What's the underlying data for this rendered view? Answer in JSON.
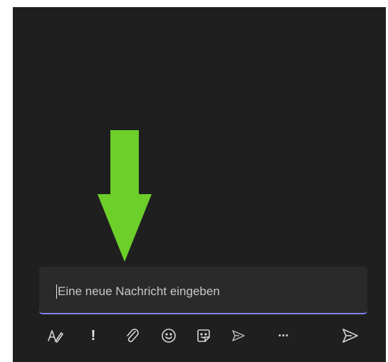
{
  "compose": {
    "placeholder": "Eine neue Nachricht eingeben",
    "accent_color": "#7f85f5"
  },
  "annotation": {
    "arrow_color": "#6ccf2a"
  },
  "toolbar": {
    "items": [
      {
        "name": "format-icon"
      },
      {
        "name": "important-icon",
        "label": "!"
      },
      {
        "name": "attach-icon"
      },
      {
        "name": "emoji-icon"
      },
      {
        "name": "sticker-icon"
      },
      {
        "name": "schedule-send-icon"
      },
      {
        "name": "more-options-icon",
        "label": "···"
      },
      {
        "name": "send-icon"
      }
    ]
  }
}
